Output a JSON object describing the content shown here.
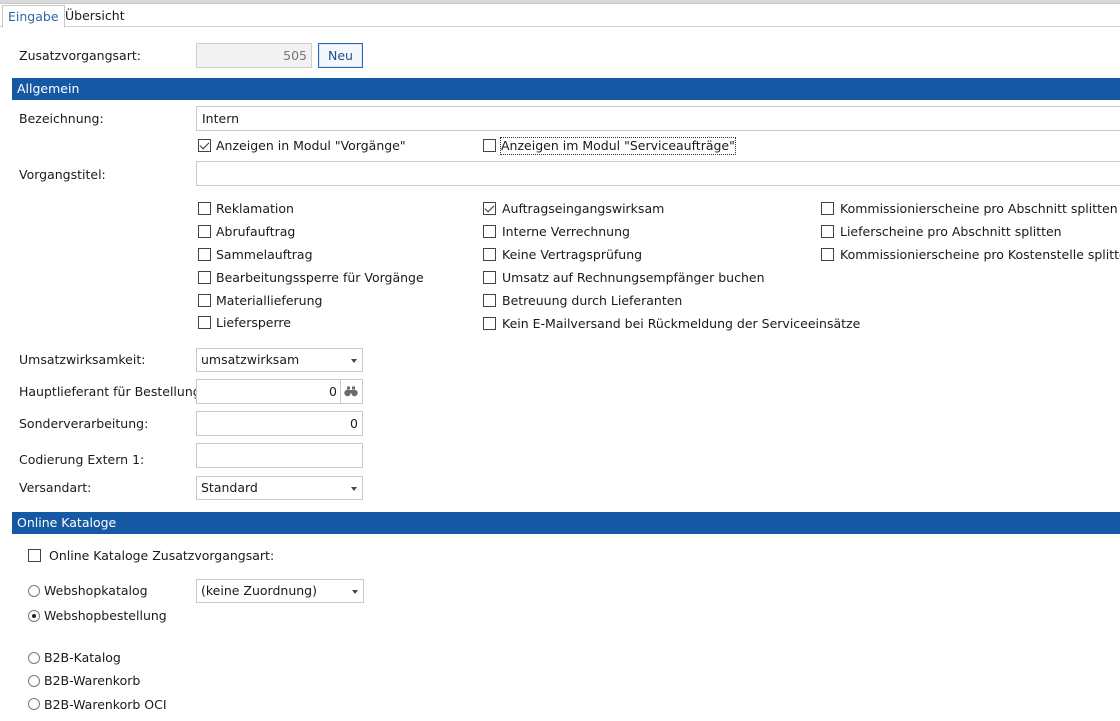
{
  "tabs": [
    {
      "label": "Eingabe",
      "active": true
    },
    {
      "label": "Übersicht",
      "active": false
    }
  ],
  "header": {
    "zusatz_label": "Zusatzvorgangsart:",
    "zusatz_value": "505",
    "neu_button": "Neu"
  },
  "sections": {
    "allgemein": "Allgemein",
    "online": "Online Kataloge"
  },
  "allgemein": {
    "bezeichnung_label": "Bezeichnung:",
    "bezeichnung_value": "Intern",
    "show_vorgaenge_label": "Anzeigen in Modul \"Vorgänge\"",
    "show_vorgaenge_checked": true,
    "show_service_label": "Anzeigen im Modul \"Serviceaufträge\"",
    "show_service_checked": false,
    "vorgangstitel_label": "Vorgangstitel:",
    "vorgangstitel_value": ""
  },
  "checkboxes": {
    "col1": [
      {
        "label": "Reklamation",
        "checked": false
      },
      {
        "label": "Abrufauftrag",
        "checked": false
      },
      {
        "label": "Sammelauftrag",
        "checked": false
      },
      {
        "label": "Bearbeitungssperre für Vorgänge",
        "checked": false
      },
      {
        "label": "Materiallieferung",
        "checked": false
      },
      {
        "label": "Liefersperre",
        "checked": false
      }
    ],
    "col2": [
      {
        "label": "Auftragseingangswirksam",
        "checked": true
      },
      {
        "label": "Interne Verrechnung",
        "checked": false
      },
      {
        "label": "Keine Vertragsprüfung",
        "checked": false
      },
      {
        "label": "Umsatz auf Rechnungsempfänger buchen",
        "checked": false
      },
      {
        "label": "Betreuung durch Lieferanten",
        "checked": false
      },
      {
        "label": "Kein E-Mailversand bei Rückmeldung der Serviceeinsätze",
        "checked": false
      }
    ],
    "col3": [
      {
        "label": "Kommissionierscheine pro Abschnitt splitten",
        "checked": false
      },
      {
        "label": "Lieferscheine pro Abschnitt splitten",
        "checked": false
      },
      {
        "label": "Kommissionierscheine pro Kostenstelle splitten",
        "checked": false
      }
    ]
  },
  "fields": {
    "umsatz_label": "Umsatzwirksamkeit:",
    "umsatz_value": "umsatzwirksam",
    "hauptlieferant_label": "Hauptlieferant für Bestellung:",
    "hauptlieferant_value": "0",
    "sonder_label": "Sonderverarbeitung:",
    "sonder_value": "0",
    "codierung_label": "Codierung Extern 1:",
    "codierung_value": "",
    "versandart_label": "Versandart:",
    "versandart_value": "Standard"
  },
  "online": {
    "checkbox_label": "Online Kataloge Zusatzvorgangsart:",
    "checkbox_checked": false,
    "radios": [
      {
        "label": "Webshopkatalog",
        "checked": false
      },
      {
        "label": "Webshopbestellung",
        "checked": true
      },
      {
        "label": "B2B-Katalog",
        "checked": false
      },
      {
        "label": "B2B-Warenkorb",
        "checked": false
      },
      {
        "label": "B2B-Warenkorb OCI",
        "checked": false
      }
    ],
    "zuordnung_value": "(keine Zuordnung)"
  }
}
